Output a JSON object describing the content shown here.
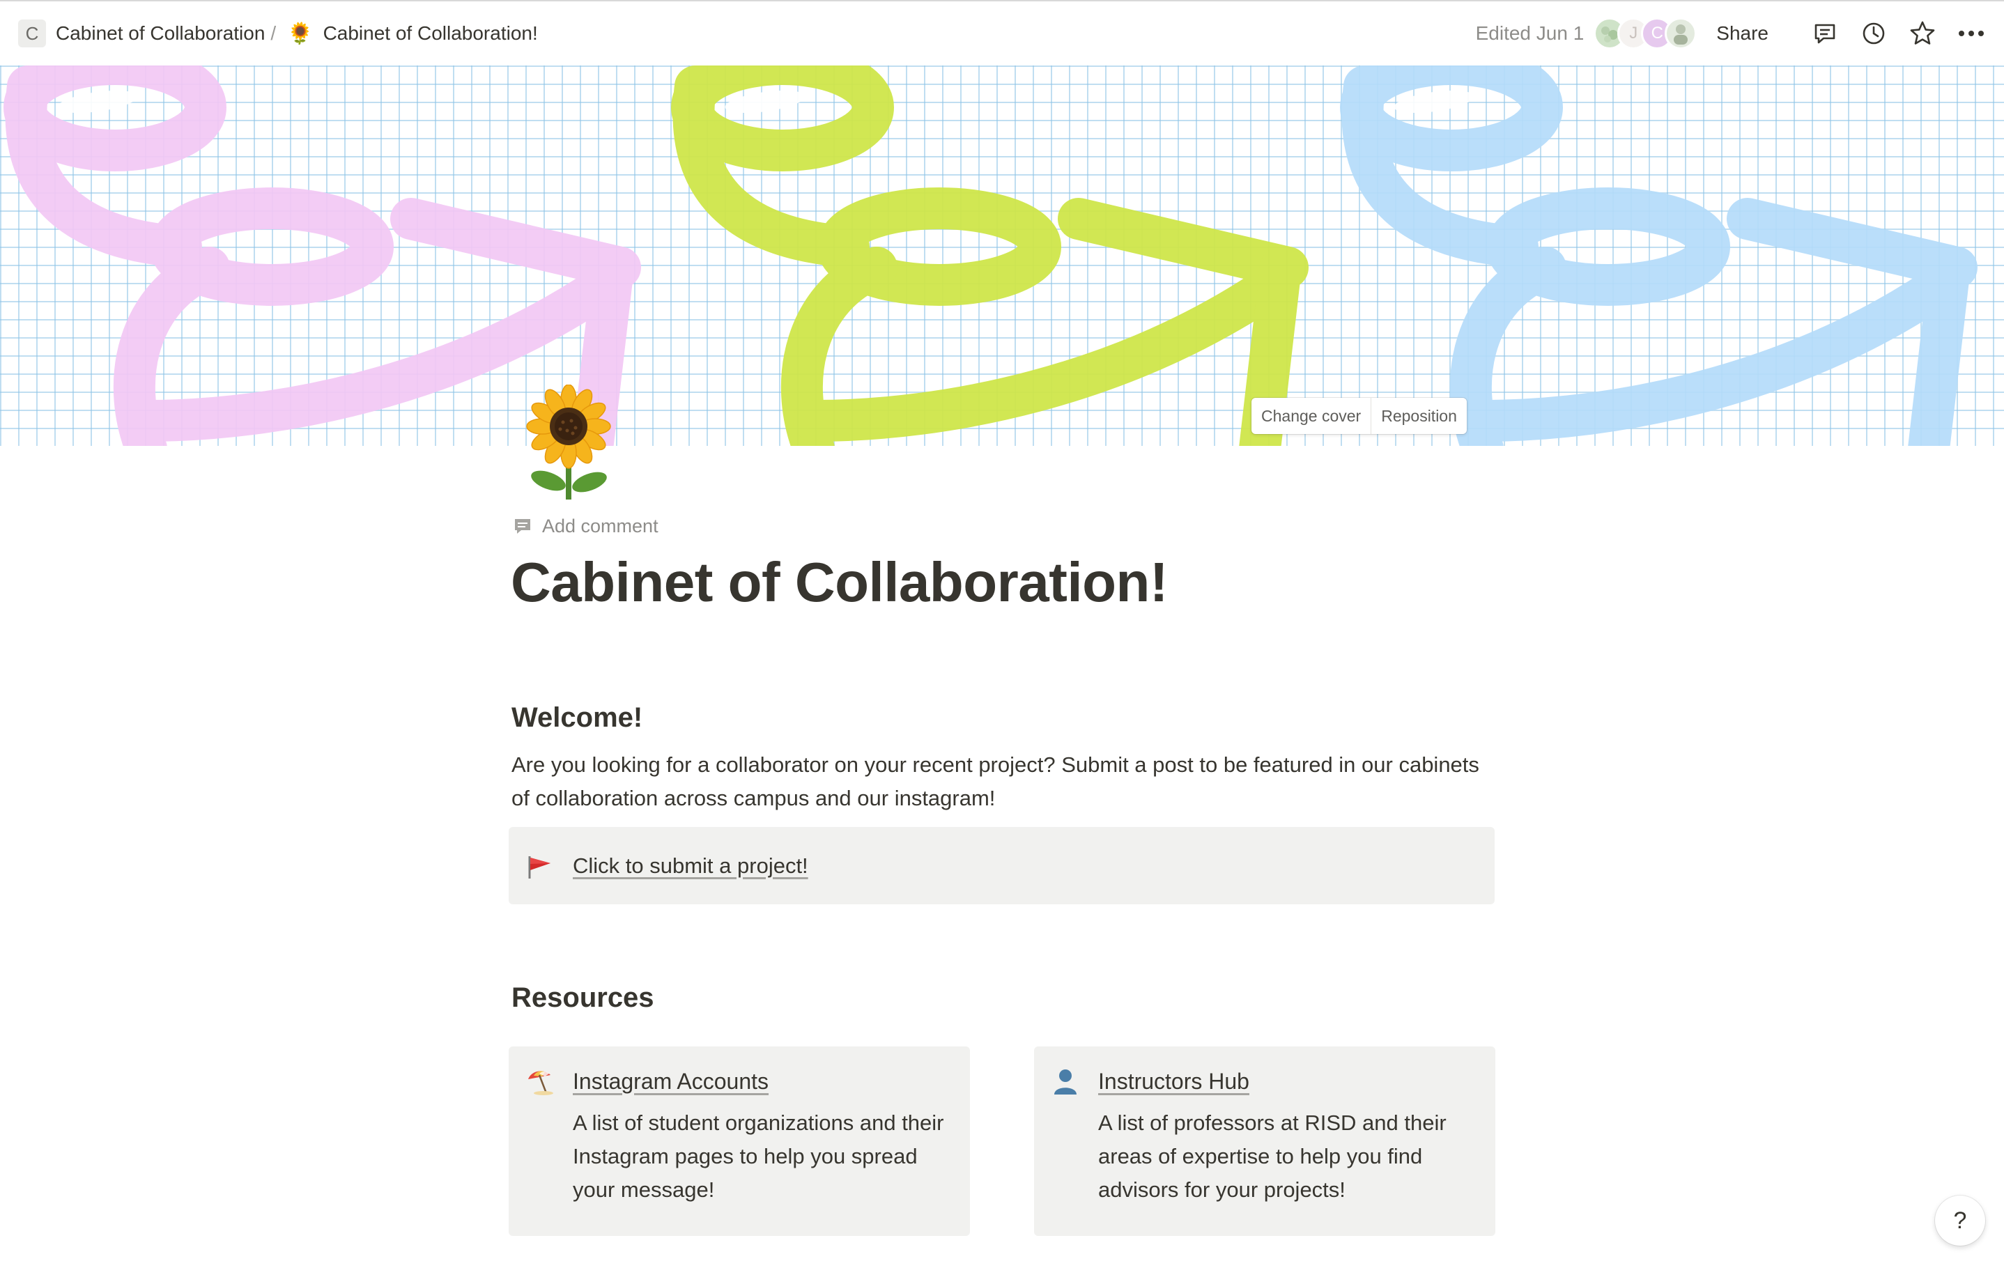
{
  "topbar": {
    "workspace_initial": "C",
    "workspace_name": "Cabinet of Collaboration",
    "separator": "/",
    "page_emoji": "🌻",
    "page_name": "Cabinet of Collaboration!",
    "edited": "Edited Jun 1",
    "avatars": [
      {
        "initial": "",
        "color": "#cfe3c8"
      },
      {
        "initial": "J",
        "color": "#f3f0ee"
      },
      {
        "initial": "C",
        "color": "#e6c9ee"
      },
      {
        "initial": "",
        "color": "#d9e4d2"
      }
    ],
    "share_label": "Share",
    "icons": [
      "comments-icon",
      "history-icon",
      "favorite-star-icon",
      "more-options-icon"
    ]
  },
  "cover": {
    "change_cover_label": "Change cover",
    "reposition_label": "Reposition",
    "colors": [
      "#f3c8f5",
      "#cfe64a",
      "#b5dcfa"
    ]
  },
  "page": {
    "icon": "sunflower-icon",
    "add_comment_label": "Add comment",
    "title": "Cabinet of Collaboration!"
  },
  "welcome": {
    "heading": "Welcome!",
    "text": "Are you looking for a collaborator on your recent project? Submit a post to be featured in our cabinets of collaboration across campus and our instagram!",
    "callout_link": "Click to submit a project!",
    "callout_icon": "red-flag-icon"
  },
  "resources": {
    "heading": "Resources",
    "cards": [
      {
        "title": "Instagram Accounts",
        "icon": "beach-umbrella-icon",
        "description": "A list of student organizations and their Instagram pages to help you spread your message!"
      },
      {
        "title": "Instructors Hub",
        "icon": "person-silhouette-icon",
        "description": "A list of professors at RISD and their areas of expertise to help you find advisors for your projects!"
      }
    ]
  },
  "help": {
    "label": "?"
  }
}
